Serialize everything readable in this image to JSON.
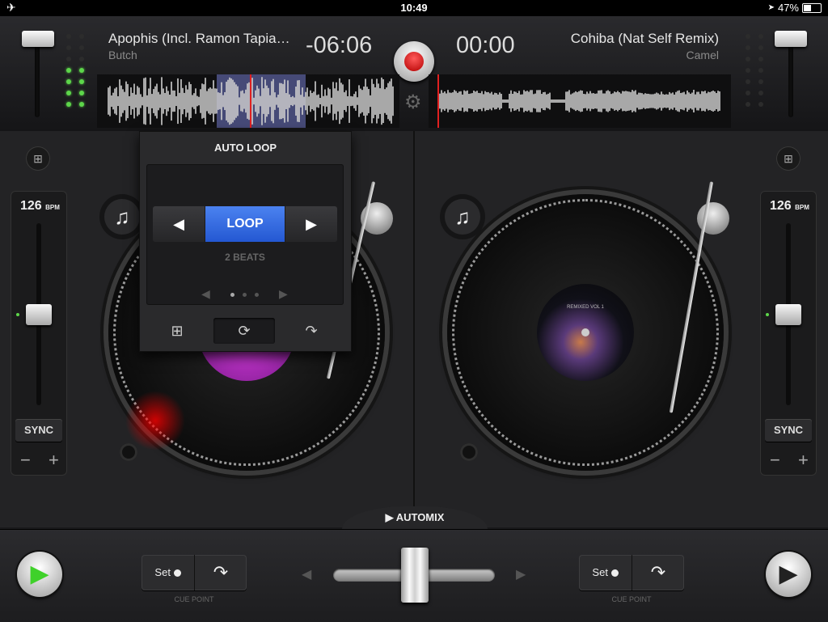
{
  "status": {
    "time": "10:49",
    "battery": "47%",
    "battery_level": 0.47
  },
  "deck_a": {
    "title": "Apophis (Incl. Ramon Tapia…",
    "artist": "Butch",
    "time": "-06:06",
    "bpm": "126",
    "bpm_unit": "BPM",
    "sync_label": "SYNC",
    "minus": "−",
    "plus": "+",
    "cue_set_label": "Set",
    "cue_caption": "CUE POINT",
    "note_icon": "♫",
    "eq_icon": "⊞"
  },
  "deck_b": {
    "title": "Cohiba (Nat Self Remix)",
    "artist": "Camel",
    "time": "00:00",
    "bpm": "126",
    "bpm_unit": "BPM",
    "sync_label": "SYNC",
    "minus": "−",
    "plus": "+",
    "cue_set_label": "Set",
    "cue_caption": "CUE POINT",
    "note_icon": "♫",
    "record_label_text": "REMIXED VOL 1",
    "eq_icon": "⊞"
  },
  "loop_panel": {
    "header": "AUTO LOOP",
    "loop_label": "LOOP",
    "beats": "2 BEATS",
    "prev_arrow": "◀",
    "next_arrow": "▶",
    "page_prev": "◀",
    "page_next": "▶"
  },
  "automix_label": "▶ AUTOMIX",
  "icons": {
    "settings": "⚙",
    "play": "▶",
    "mixer": "⊞",
    "loop": "⟳",
    "jump": "↷"
  },
  "colors": {
    "accent_blue": "#3a6fe6",
    "led_green": "#5dd64a",
    "record_red": "#d40000",
    "play_green": "#3fd12a"
  }
}
